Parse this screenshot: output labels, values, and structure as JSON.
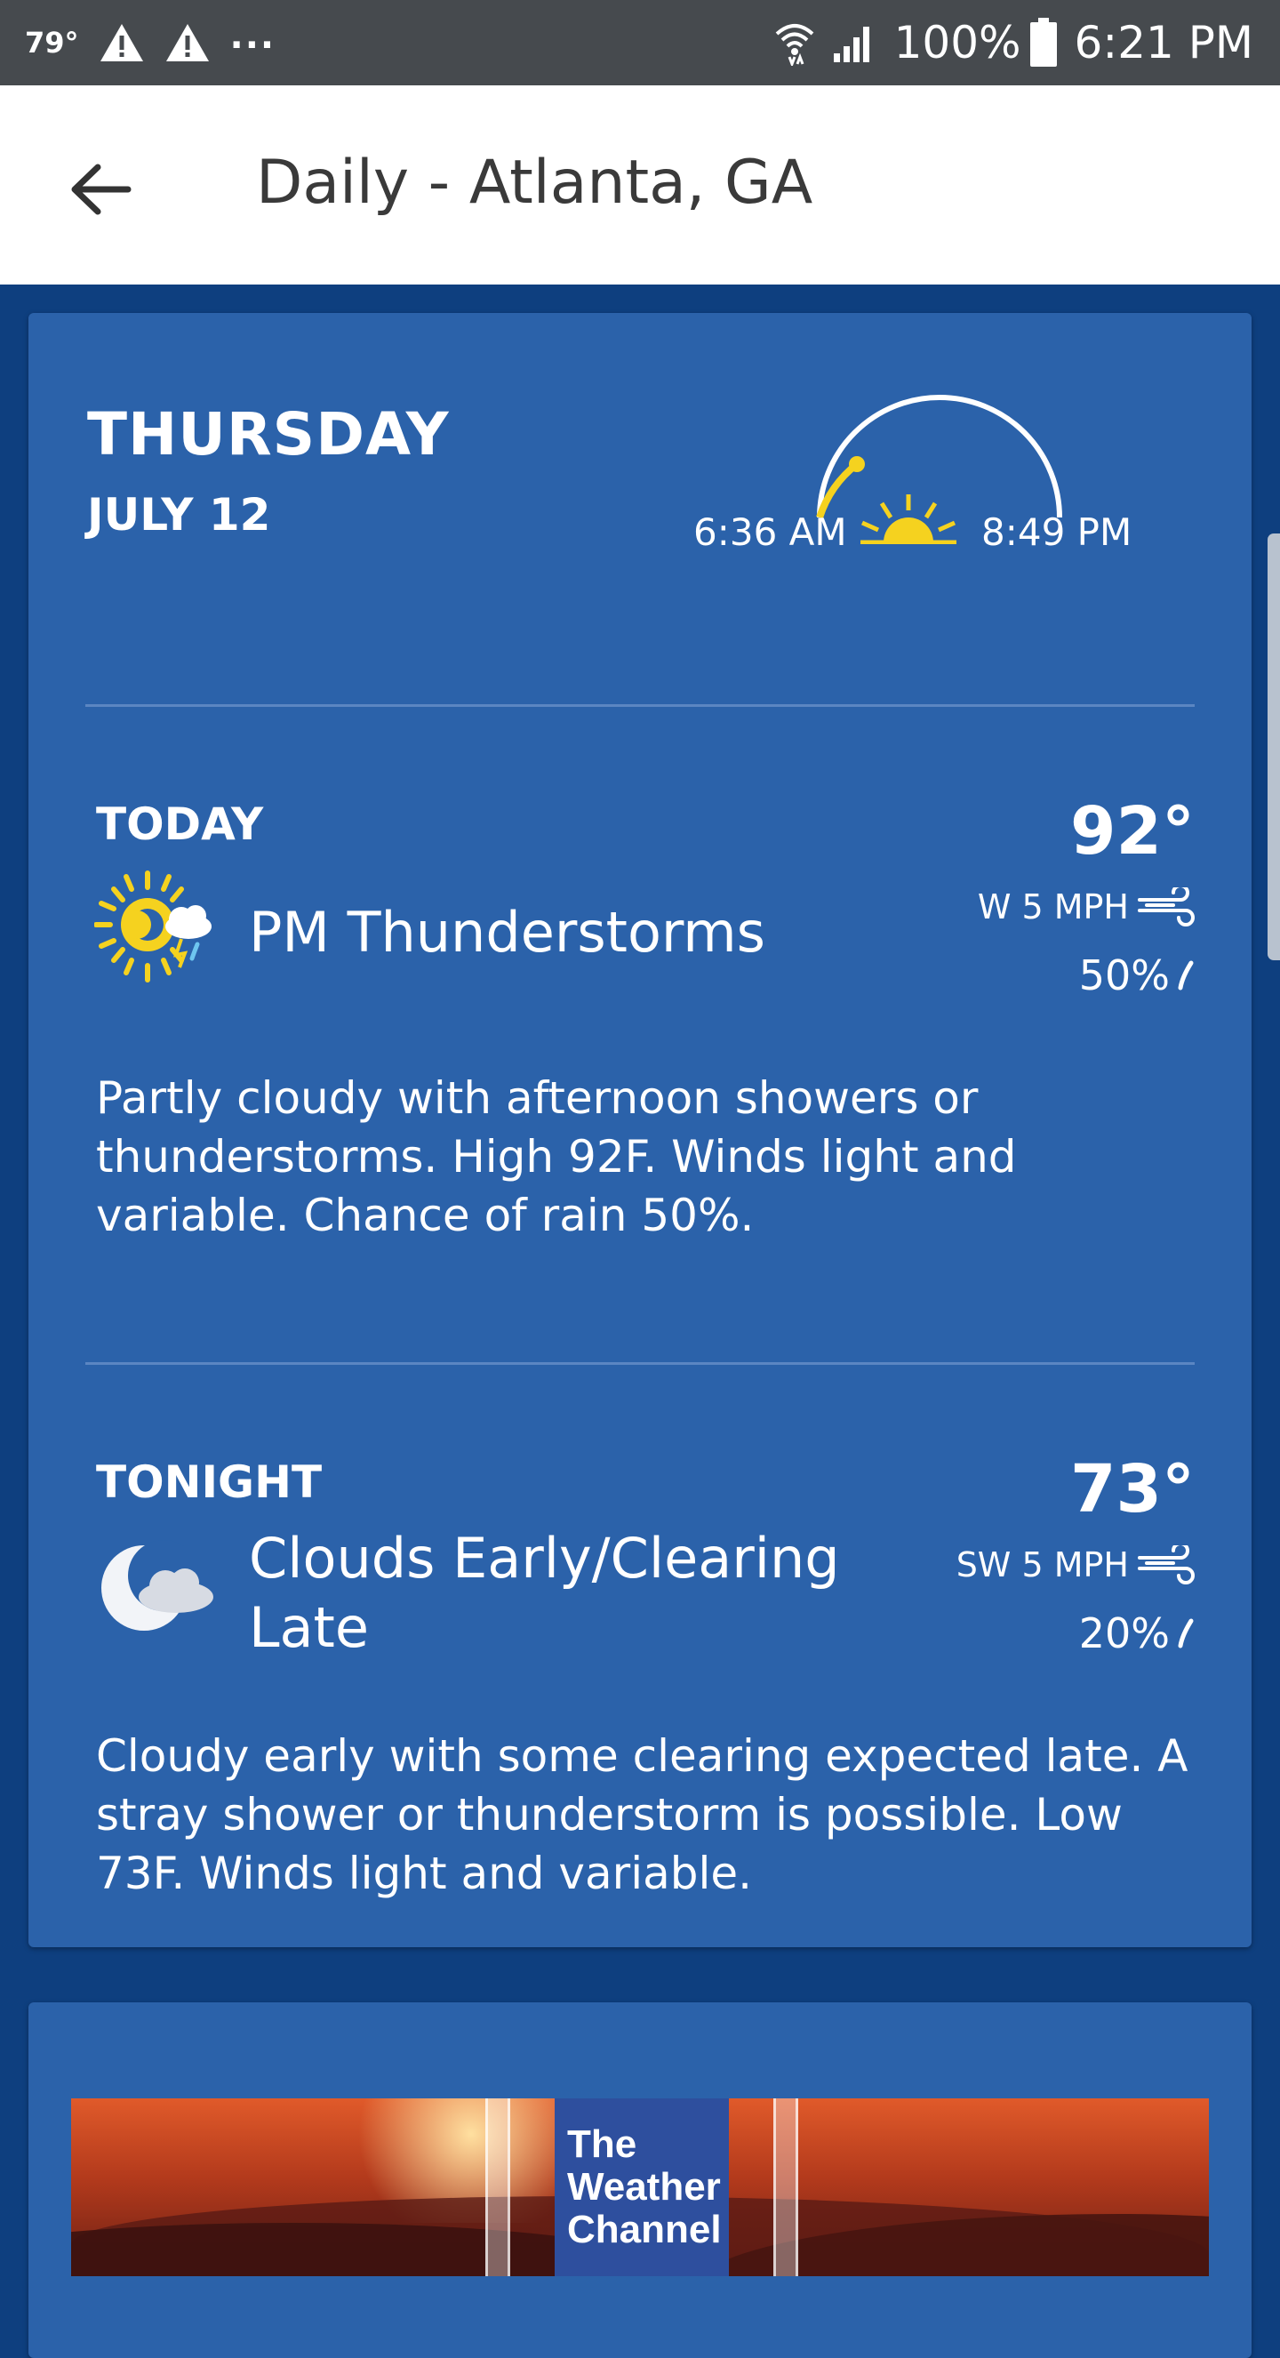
{
  "status_bar": {
    "temperature": "79°",
    "alerts": [
      "warning-icon",
      "warning-icon"
    ],
    "more": "...",
    "battery": "100%",
    "time": "6:21 PM"
  },
  "app_bar": {
    "title": "Daily - Atlanta, GA"
  },
  "day": {
    "name": "THURSDAY",
    "date": "JULY 12",
    "sunrise": "6:36 AM",
    "sunset": "8:49 PM"
  },
  "periods": [
    {
      "label": "TODAY",
      "condition": "PM Thunderstorms",
      "temperature": "92°",
      "wind": "W 5 MPH",
      "precip_chance": "50%",
      "narrative": "Partly cloudy with afternoon showers or thunderstorms. High 92F. Winds light and variable. Chance of rain 50%.",
      "icon": "pm-thunderstorms-icon"
    },
    {
      "label": "TONIGHT",
      "condition": "Clouds Early/Clearing Late",
      "temperature": "73°",
      "wind": "SW 5 MPH",
      "precip_chance": "20%",
      "narrative": "Cloudy early with some clearing expected late. A stray shower or thunderstorm is possible. Low 73F. Winds light and variable.",
      "icon": "moon-cloud-icon"
    }
  ],
  "ad": {
    "brand_line1": "The",
    "brand_line2": "Weather",
    "brand_line3": "Channel"
  },
  "colors": {
    "page_background": "#0e3f7f",
    "card_background": "#2b62aa",
    "status_bar": "#464a4e",
    "sun_yellow": "#f5d21f"
  }
}
